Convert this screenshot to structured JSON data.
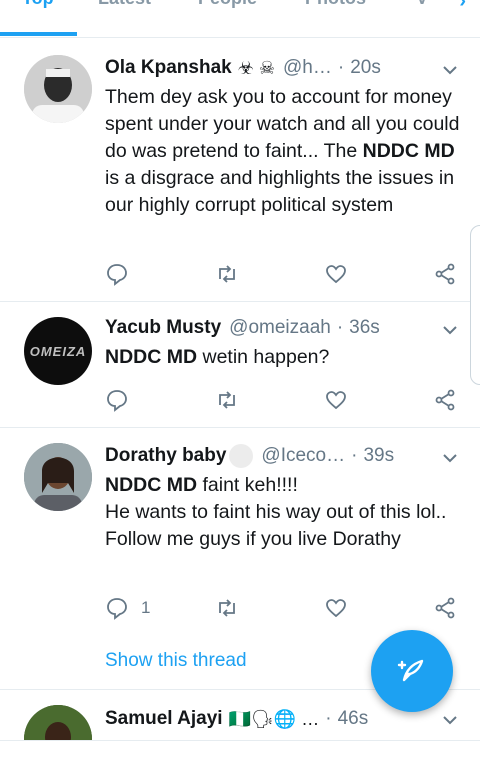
{
  "tabs": [
    {
      "label": "Top",
      "active": true
    },
    {
      "label": "Latest",
      "active": false
    },
    {
      "label": "People",
      "active": false
    },
    {
      "label": "Photos",
      "active": false
    },
    {
      "label": "V",
      "active": false
    }
  ],
  "tweets": [
    {
      "name": "Ola Kpanshak",
      "name_emojis": "☣ ☠",
      "handle": "@h…",
      "time": "20s",
      "body_parts": {
        "pre": "Them dey ask you to account for money spent under your watch and all you could do was pretend to faint... The ",
        "bold": "NDDC MD",
        "post": " is a disgrace and highlights the issues in our highly corrupt political system"
      },
      "reply_count": "",
      "avatar_icon": "person-photo-icon"
    },
    {
      "name": "Yacub Musty",
      "handle": "@omeizaah",
      "time": "36s",
      "body_parts": {
        "pre": "",
        "bold": "NDDC MD",
        "post": " wetin happen?"
      },
      "reply_count": "",
      "avatar_text": "OMEIZA"
    },
    {
      "name": "Dorathy baby",
      "handle": "@Iceco…",
      "time": "39s",
      "body_parts": {
        "pre": "",
        "bold": "NDDC MD",
        "post": " faint keh!!!!"
      },
      "body_lines": [
        "He wants to faint his way out of this lol..",
        "Follow me guys if you live Dorathy"
      ],
      "reply_count": "1",
      "show_thread": "Show this thread",
      "avatar_icon": "person-photo-icon"
    },
    {
      "name": "Samuel Ajayi",
      "name_emojis": "🇳🇬🗣🌐 …",
      "time": "46s",
      "avatar_icon": "person-photo-icon"
    }
  ],
  "colors": {
    "accent": "#1da1f2",
    "text": "#14171a",
    "muted": "#657786",
    "divider": "#e6ecf0"
  },
  "fab_icon": "compose-tweet-icon"
}
